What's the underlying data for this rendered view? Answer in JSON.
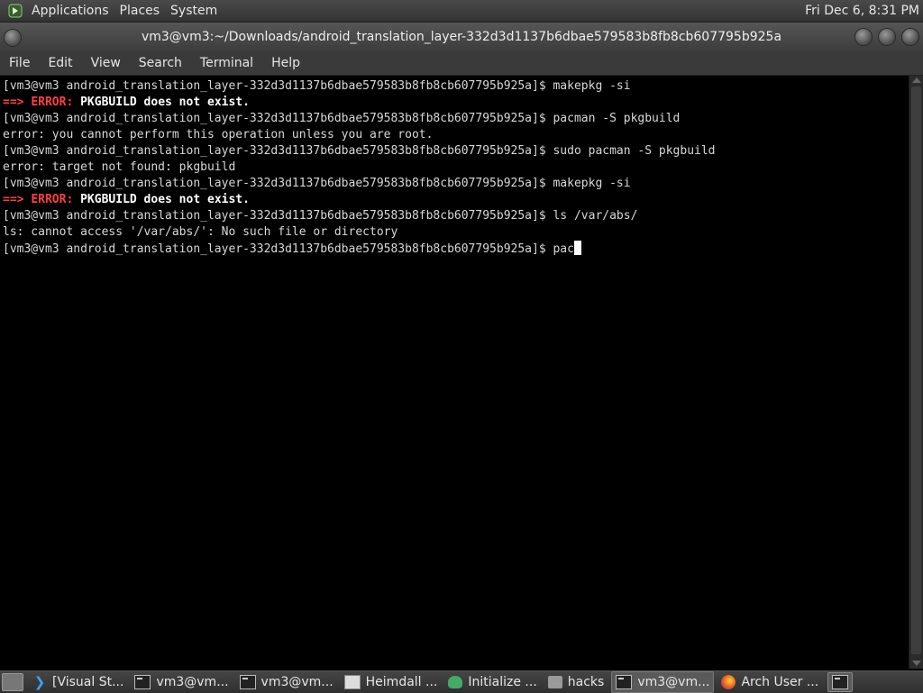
{
  "top_panel": {
    "menus": [
      "Applications",
      "Places",
      "System"
    ],
    "clock": "Fri Dec  6,  8:31 PM"
  },
  "window": {
    "title": "vm3@vm3:~/Downloads/android_translation_layer-332d3d1137b6dbae579583b8fb8cb607795b925a"
  },
  "menu_bar": [
    "File",
    "Edit",
    "View",
    "Search",
    "Terminal",
    "Help"
  ],
  "terminal": {
    "prompt": "[vm3@vm3 android_translation_layer-332d3d1137b6dbae579583b8fb8cb607795b925a]$ ",
    "lines": [
      {
        "type": "cmd",
        "text": "makepkg -si"
      },
      {
        "type": "error",
        "arrow": "==> ",
        "label": "ERROR: ",
        "msg": "PKGBUILD does not exist."
      },
      {
        "type": "cmd",
        "text": "pacman -S pkgbuild"
      },
      {
        "type": "out",
        "text": "error: you cannot perform this operation unless you are root."
      },
      {
        "type": "cmd",
        "text": "sudo pacman -S pkgbuild"
      },
      {
        "type": "out",
        "text": "error: target not found: pkgbuild"
      },
      {
        "type": "cmd",
        "text": "makepkg -si"
      },
      {
        "type": "error",
        "arrow": "==> ",
        "label": "ERROR: ",
        "msg": "PKGBUILD does not exist."
      },
      {
        "type": "cmd",
        "text": "ls /var/abs/"
      },
      {
        "type": "out",
        "text": "ls: cannot access '/var/abs/': No such file or directory"
      },
      {
        "type": "input",
        "text": "pac"
      }
    ]
  },
  "taskbar": {
    "items": [
      {
        "label": "[Visual St...",
        "icon": "vscode-icon",
        "active": false
      },
      {
        "label": "vm3@vm...",
        "icon": "terminal-icon",
        "active": false
      },
      {
        "label": "vm3@vm...",
        "icon": "terminal-icon",
        "active": false
      },
      {
        "label": "Heimdall ...",
        "icon": "document-icon",
        "active": false
      },
      {
        "label": "Initialize ...",
        "icon": "ghost-icon",
        "active": false
      },
      {
        "label": "hacks",
        "icon": "folder-icon",
        "active": false
      },
      {
        "label": "vm3@vm...",
        "icon": "terminal-icon",
        "active": true
      },
      {
        "label": "Arch User ...",
        "icon": "firefox-icon",
        "active": false
      }
    ]
  }
}
